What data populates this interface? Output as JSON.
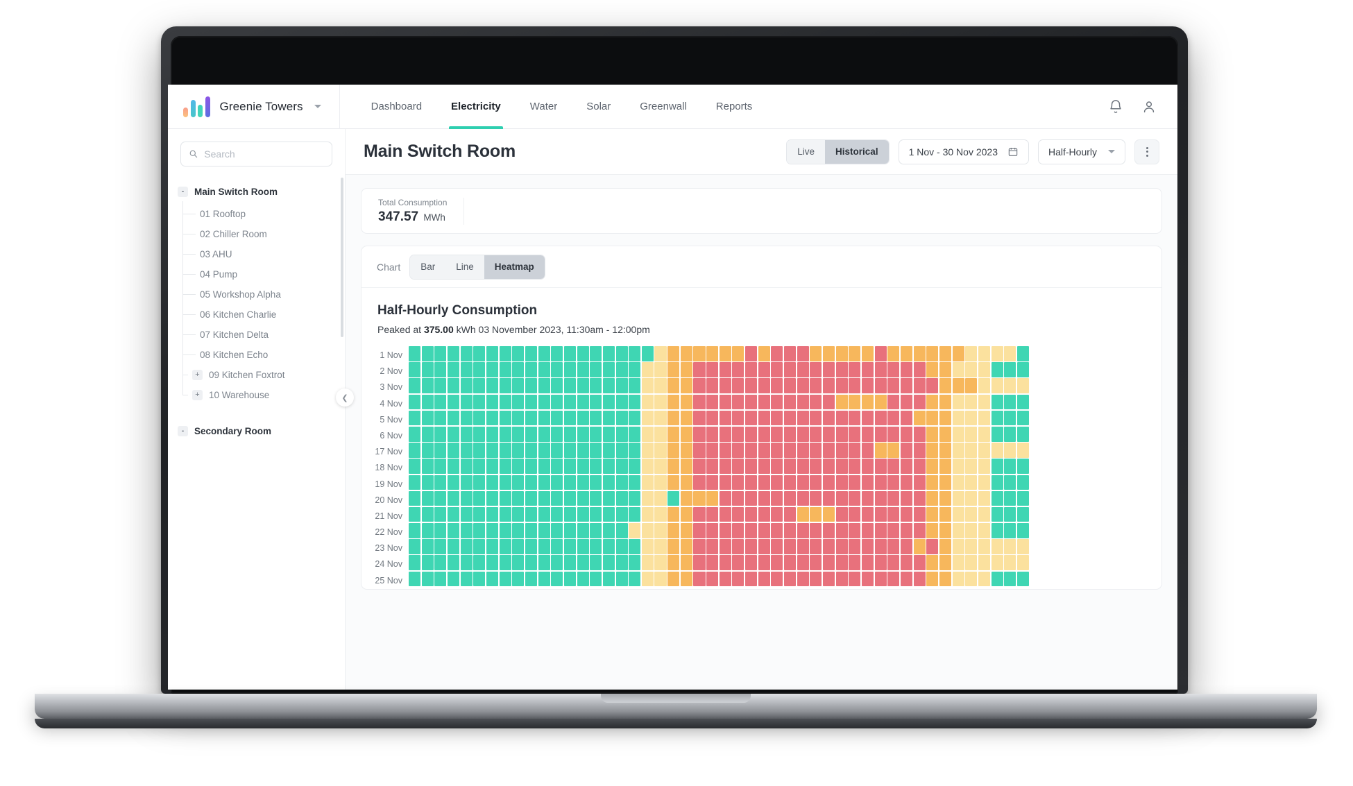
{
  "app": {
    "brand_name": "Greenie Towers",
    "logo_icon": "bar-logo-icon",
    "chevron_icon": "chevron-down-icon"
  },
  "nav": {
    "items": [
      {
        "label": "Dashboard",
        "active": false
      },
      {
        "label": "Electricity",
        "active": true
      },
      {
        "label": "Water",
        "active": false
      },
      {
        "label": "Solar",
        "active": false
      },
      {
        "label": "Greenwall",
        "active": false
      },
      {
        "label": "Reports",
        "active": false
      }
    ],
    "notification_icon": "bell-icon",
    "account_icon": "user-icon"
  },
  "sidebar": {
    "search": {
      "placeholder": "Search",
      "value": "",
      "icon": "search-icon"
    },
    "collapse_icon": "chevron-left-icon",
    "groups": [
      {
        "label": "Main Switch Room",
        "toggle": "-",
        "items": [
          {
            "label": "01 Rooftop",
            "toggle": ""
          },
          {
            "label": "02 Chiller Room",
            "toggle": ""
          },
          {
            "label": "03 AHU",
            "toggle": ""
          },
          {
            "label": "04 Pump",
            "toggle": ""
          },
          {
            "label": "05 Workshop Alpha",
            "toggle": ""
          },
          {
            "label": "06 Kitchen Charlie",
            "toggle": ""
          },
          {
            "label": "07 Kitchen Delta",
            "toggle": ""
          },
          {
            "label": "08 Kitchen Echo",
            "toggle": ""
          },
          {
            "label": "09 Kitchen Foxtrot",
            "toggle": "+"
          },
          {
            "label": "10 Warehouse",
            "toggle": "+"
          }
        ]
      },
      {
        "label": "Secondary Room",
        "toggle": "-",
        "items": []
      }
    ]
  },
  "main": {
    "page_title": "Main Switch Room",
    "mode_toggle": {
      "options": [
        "Live",
        "Historical"
      ],
      "selected": "Historical"
    },
    "date_range": {
      "value": "1 Nov - 30 Nov 2023",
      "icon": "calendar-icon"
    },
    "interval": {
      "value": "Half-Hourly",
      "icon": "chevron-down-icon"
    },
    "more_menu_icon": "kebab-menu-icon",
    "kpi": {
      "label": "Total Consumption",
      "value": "347.57",
      "unit": "MWh"
    },
    "chart_controls": {
      "label": "Chart",
      "options": [
        "Bar",
        "Line",
        "Heatmap"
      ],
      "selected": "Heatmap"
    },
    "chart_title": "Half-Hourly Consumption",
    "chart_subtitle_prefix": "Peaked at ",
    "chart_peak_value": "375.00",
    "chart_subtitle_suffix": " kWh 03 November 2023, 11:30am - 12:00pm"
  },
  "chart_data": {
    "type": "heatmap",
    "title": "Half-Hourly Consumption",
    "subtitle": "Peaked at 375.00 kWh 03 November 2023, 11:30am - 12:00pm",
    "xlabel": "",
    "ylabel": "",
    "interval": "Half-Hourly",
    "columns": 48,
    "peak_value": 375.0,
    "unit": "kWh",
    "legend_position": "none",
    "grid": true,
    "color_scale": [
      {
        "name": "low",
        "hex": "#3fd6b3"
      },
      {
        "name": "mid-low",
        "hex": "#fbe19e"
      },
      {
        "name": "mid-high",
        "hex": "#f7b75c"
      },
      {
        "name": "high",
        "hex": "#e8717c"
      }
    ],
    "rows": [
      {
        "label": "1 Nov",
        "levels": [
          0,
          0,
          0,
          0,
          0,
          0,
          0,
          0,
          0,
          0,
          0,
          0,
          0,
          0,
          0,
          0,
          0,
          0,
          0,
          1,
          2,
          2,
          2,
          2,
          2,
          2,
          3,
          2,
          3,
          3,
          3,
          2,
          2,
          2,
          2,
          2,
          3,
          2,
          2,
          2,
          2,
          2,
          2,
          1,
          1,
          1,
          1,
          0
        ]
      },
      {
        "label": "2 Nov",
        "levels": [
          0,
          0,
          0,
          0,
          0,
          0,
          0,
          0,
          0,
          0,
          0,
          0,
          0,
          0,
          0,
          0,
          0,
          0,
          1,
          1,
          2,
          2,
          3,
          3,
          3,
          3,
          3,
          3,
          3,
          3,
          3,
          3,
          3,
          3,
          3,
          3,
          3,
          3,
          3,
          3,
          2,
          2,
          1,
          1,
          1,
          0,
          0,
          0
        ]
      },
      {
        "label": "3 Nov",
        "levels": [
          0,
          0,
          0,
          0,
          0,
          0,
          0,
          0,
          0,
          0,
          0,
          0,
          0,
          0,
          0,
          0,
          0,
          0,
          1,
          1,
          2,
          2,
          3,
          3,
          3,
          3,
          3,
          3,
          3,
          3,
          3,
          3,
          3,
          3,
          3,
          3,
          3,
          3,
          3,
          3,
          3,
          2,
          2,
          2,
          1,
          1,
          1,
          1
        ]
      },
      {
        "label": "4 Nov",
        "levels": [
          0,
          0,
          0,
          0,
          0,
          0,
          0,
          0,
          0,
          0,
          0,
          0,
          0,
          0,
          0,
          0,
          0,
          0,
          1,
          1,
          2,
          2,
          3,
          3,
          3,
          3,
          3,
          3,
          3,
          3,
          3,
          3,
          3,
          2,
          2,
          2,
          2,
          3,
          3,
          3,
          2,
          2,
          1,
          1,
          1,
          0,
          0,
          0
        ]
      },
      {
        "label": "5 Nov",
        "levels": [
          0,
          0,
          0,
          0,
          0,
          0,
          0,
          0,
          0,
          0,
          0,
          0,
          0,
          0,
          0,
          0,
          0,
          0,
          1,
          1,
          2,
          2,
          3,
          3,
          3,
          3,
          3,
          3,
          3,
          3,
          3,
          3,
          3,
          3,
          3,
          3,
          3,
          3,
          3,
          2,
          2,
          2,
          1,
          1,
          1,
          0,
          0,
          0
        ]
      },
      {
        "label": "6 Nov",
        "levels": [
          0,
          0,
          0,
          0,
          0,
          0,
          0,
          0,
          0,
          0,
          0,
          0,
          0,
          0,
          0,
          0,
          0,
          0,
          1,
          1,
          2,
          2,
          3,
          3,
          3,
          3,
          3,
          3,
          3,
          3,
          3,
          3,
          3,
          3,
          3,
          3,
          3,
          3,
          3,
          3,
          2,
          2,
          1,
          1,
          1,
          0,
          0,
          0
        ]
      },
      {
        "label": "17 Nov",
        "levels": [
          0,
          0,
          0,
          0,
          0,
          0,
          0,
          0,
          0,
          0,
          0,
          0,
          0,
          0,
          0,
          0,
          0,
          0,
          1,
          1,
          2,
          2,
          3,
          3,
          3,
          3,
          3,
          3,
          3,
          3,
          3,
          3,
          3,
          3,
          3,
          3,
          2,
          2,
          3,
          3,
          2,
          2,
          1,
          1,
          1,
          1,
          1,
          1
        ]
      },
      {
        "label": "18 Nov",
        "levels": [
          0,
          0,
          0,
          0,
          0,
          0,
          0,
          0,
          0,
          0,
          0,
          0,
          0,
          0,
          0,
          0,
          0,
          0,
          1,
          1,
          2,
          2,
          3,
          3,
          3,
          3,
          3,
          3,
          3,
          3,
          3,
          3,
          3,
          3,
          3,
          3,
          3,
          3,
          3,
          3,
          2,
          2,
          1,
          1,
          1,
          0,
          0,
          0
        ]
      },
      {
        "label": "19 Nov",
        "levels": [
          0,
          0,
          0,
          0,
          0,
          0,
          0,
          0,
          0,
          0,
          0,
          0,
          0,
          0,
          0,
          0,
          0,
          0,
          1,
          1,
          2,
          2,
          3,
          3,
          3,
          3,
          3,
          3,
          3,
          3,
          3,
          3,
          3,
          3,
          3,
          3,
          3,
          3,
          3,
          3,
          2,
          2,
          1,
          1,
          1,
          0,
          0,
          0
        ]
      },
      {
        "label": "20 Nov",
        "levels": [
          0,
          0,
          0,
          0,
          0,
          0,
          0,
          0,
          0,
          0,
          0,
          0,
          0,
          0,
          0,
          0,
          0,
          0,
          1,
          1,
          0,
          2,
          2,
          2,
          3,
          3,
          3,
          3,
          3,
          3,
          3,
          3,
          3,
          3,
          3,
          3,
          3,
          3,
          3,
          3,
          2,
          2,
          1,
          1,
          1,
          0,
          0,
          0
        ]
      },
      {
        "label": "21 Nov",
        "levels": [
          0,
          0,
          0,
          0,
          0,
          0,
          0,
          0,
          0,
          0,
          0,
          0,
          0,
          0,
          0,
          0,
          0,
          0,
          1,
          1,
          2,
          2,
          3,
          3,
          3,
          3,
          3,
          3,
          3,
          3,
          2,
          2,
          2,
          3,
          3,
          3,
          3,
          3,
          3,
          3,
          2,
          2,
          1,
          1,
          1,
          0,
          0,
          0
        ]
      },
      {
        "label": "22 Nov",
        "levels": [
          0,
          0,
          0,
          0,
          0,
          0,
          0,
          0,
          0,
          0,
          0,
          0,
          0,
          0,
          0,
          0,
          0,
          1,
          1,
          1,
          2,
          2,
          3,
          3,
          3,
          3,
          3,
          3,
          3,
          3,
          3,
          3,
          3,
          3,
          3,
          3,
          3,
          3,
          3,
          3,
          2,
          2,
          1,
          1,
          1,
          0,
          0,
          0
        ]
      },
      {
        "label": "23 Nov",
        "levels": [
          0,
          0,
          0,
          0,
          0,
          0,
          0,
          0,
          0,
          0,
          0,
          0,
          0,
          0,
          0,
          0,
          0,
          0,
          1,
          1,
          2,
          2,
          3,
          3,
          3,
          3,
          3,
          3,
          3,
          3,
          3,
          3,
          3,
          3,
          3,
          3,
          3,
          3,
          3,
          2,
          3,
          2,
          1,
          1,
          1,
          1,
          1,
          1
        ]
      },
      {
        "label": "24 Nov",
        "levels": [
          0,
          0,
          0,
          0,
          0,
          0,
          0,
          0,
          0,
          0,
          0,
          0,
          0,
          0,
          0,
          0,
          0,
          0,
          1,
          1,
          2,
          2,
          3,
          3,
          3,
          3,
          3,
          3,
          3,
          3,
          3,
          3,
          3,
          3,
          3,
          3,
          3,
          3,
          3,
          3,
          2,
          2,
          1,
          1,
          1,
          1,
          1,
          1
        ]
      },
      {
        "label": "25 Nov",
        "levels": [
          0,
          0,
          0,
          0,
          0,
          0,
          0,
          0,
          0,
          0,
          0,
          0,
          0,
          0,
          0,
          0,
          0,
          0,
          1,
          1,
          2,
          2,
          3,
          3,
          3,
          3,
          3,
          3,
          3,
          3,
          3,
          3,
          3,
          3,
          3,
          3,
          3,
          3,
          3,
          3,
          2,
          2,
          1,
          1,
          1,
          0,
          0,
          0
        ]
      }
    ]
  }
}
